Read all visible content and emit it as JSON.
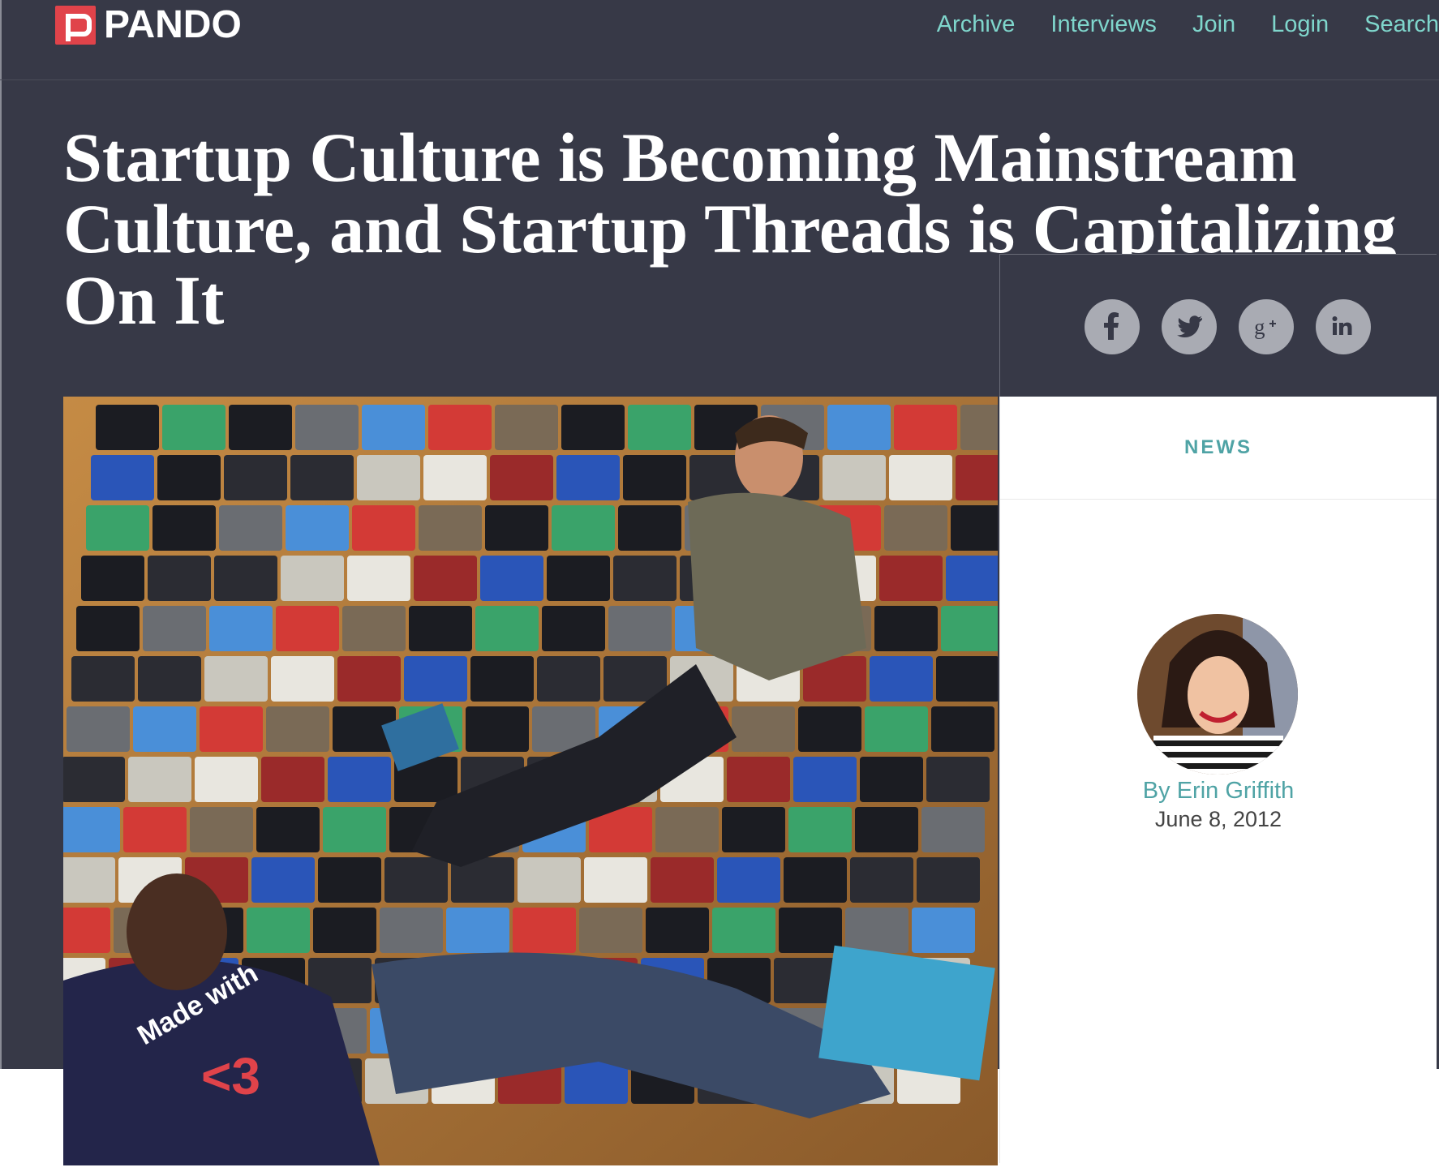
{
  "site": {
    "logo_text": "PANDO"
  },
  "nav": [
    "Archive",
    "Interviews",
    "Join",
    "Login",
    "Search"
  ],
  "article": {
    "title": "Startup Culture is Becoming Mainstream Culture, and Startup Threads is Capitalizing On It",
    "category": "NEWS",
    "byline": "By Erin Griffith",
    "date": "June 8, 2012"
  },
  "share": [
    "facebook-icon",
    "twitter-icon",
    "google-plus-icon",
    "linkedin-icon"
  ],
  "colors": {
    "background": "#373947",
    "accent": "#7fd6cc",
    "teal": "#4fa3a5",
    "logo_red": "#e0434a"
  }
}
